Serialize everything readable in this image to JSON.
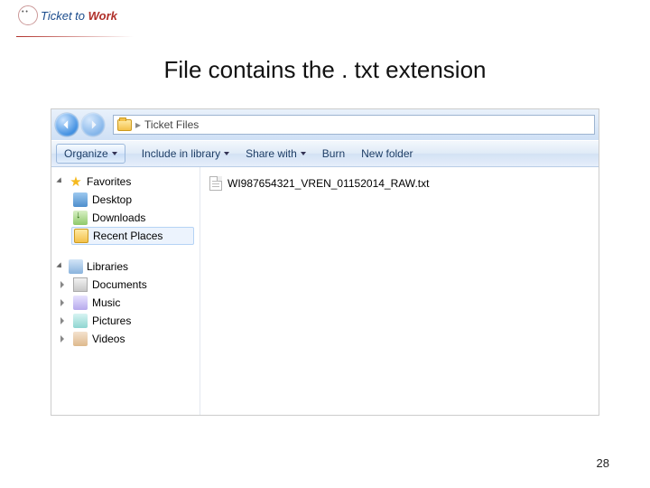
{
  "logo": {
    "text_a": "Ticket to",
    "text_b": "Work"
  },
  "slide": {
    "title": "File contains the . txt extension",
    "page": "28"
  },
  "explorer": {
    "address": {
      "location": "Ticket Files"
    },
    "toolbar": {
      "organize": "Organize",
      "include": "Include in library",
      "share": "Share with",
      "burn": "Burn",
      "newfolder": "New folder"
    },
    "side": {
      "favorites": {
        "label": "Favorites",
        "desktop": "Desktop",
        "downloads": "Downloads",
        "recent": "Recent Places"
      },
      "libraries": {
        "label": "Libraries",
        "documents": "Documents",
        "music": "Music",
        "pictures": "Pictures",
        "videos": "Videos"
      }
    },
    "file": {
      "name": "WI987654321_VREN_01152014_RAW.txt"
    }
  }
}
